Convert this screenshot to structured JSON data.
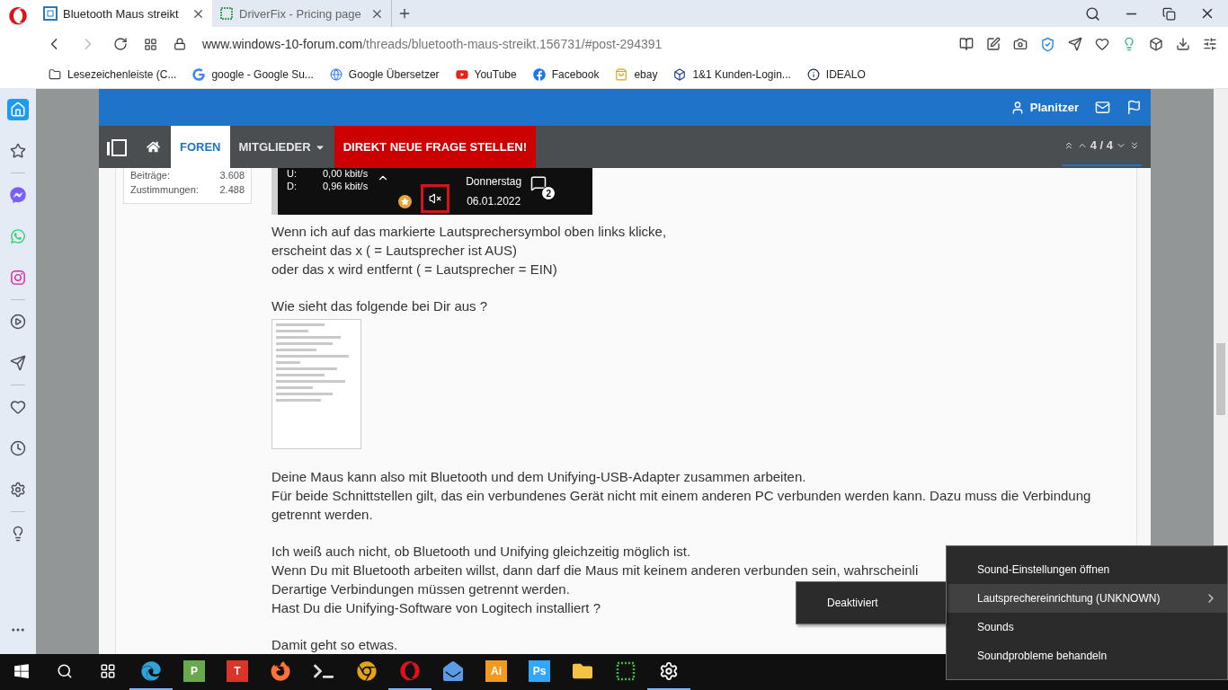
{
  "browser_tabs": [
    {
      "title": "Bluetooth Maus streikt",
      "selected": true,
      "kind": "forum"
    },
    {
      "title": "DriverFix - Pricing page",
      "selected": false,
      "kind": "dots"
    }
  ],
  "address": {
    "host": "www.windows-10-forum.com",
    "path": "/threads/bluetooth-maus-streikt.156731/#post-294391"
  },
  "bookmarks": [
    {
      "kind": "folder",
      "label": "Lesezeichenleiste (C..."
    },
    {
      "kind": "google",
      "label": "google - Google Su..."
    },
    {
      "kind": "translate",
      "label": "Google Übersetzer"
    },
    {
      "kind": "youtube",
      "label": "YouTube"
    },
    {
      "kind": "facebook",
      "label": "Facebook"
    },
    {
      "kind": "bag",
      "label": "ebay"
    },
    {
      "kind": "square",
      "label": "1&1 Kunden-Login..."
    },
    {
      "kind": "info",
      "label": "IDEALO"
    }
  ],
  "sidebar": {
    "groups": [
      {
        "items": [
          {
            "kind": "home",
            "selected": true
          },
          {
            "kind": "star",
            "selected": false
          }
        ]
      },
      {
        "items": [
          {
            "kind": "messenger",
            "selected": false
          },
          {
            "kind": "whatsapp",
            "selected": false
          },
          {
            "kind": "instagram",
            "selected": false
          }
        ]
      },
      {
        "items": [
          {
            "kind": "play",
            "selected": false
          },
          {
            "kind": "send",
            "selected": false
          }
        ]
      },
      {
        "items": [
          {
            "kind": "heart",
            "selected": false
          },
          {
            "kind": "clock",
            "selected": false
          },
          {
            "kind": "settings",
            "selected": false
          }
        ]
      },
      {
        "items": [
          {
            "kind": "bulb",
            "selected": false
          }
        ]
      }
    ]
  },
  "forum_header": {
    "user": "Planitzer"
  },
  "forum_nav": [
    {
      "kind": "tab",
      "label": "FOREN",
      "selected": true
    },
    {
      "kind": "dropdown",
      "label": "MITGLIEDER",
      "selected": false
    },
    {
      "kind": "cta",
      "label": "DIREKT NEUE FRAGE STELLEN!",
      "selected": false
    }
  ],
  "pager": {
    "text": "4 / 4"
  },
  "user_stats": [
    {
      "label": "Beiträge:",
      "value": "3.608"
    },
    {
      "label": "Zustimmungen:",
      "value": "2.488"
    }
  ],
  "embedded_screenshot": {
    "upload_label": "U:",
    "upload": "0,00 kbit/s",
    "download_label": "D:",
    "download": "0,96 kbit/s",
    "day": "Donnerstag",
    "date": "06.01.2022",
    "notifications": "2",
    "muted": true
  },
  "post": [
    {
      "kind": "paragraph",
      "lines": [
        "Wenn ich auf das markierte Lautsprechersymbol oben links klicke,",
        "erscheint das x ( = Lautsprecher ist AUS)",
        "oder das x wird entfernt ( = Lautsprecher = EIN)"
      ]
    },
    {
      "kind": "paragraph",
      "lines": [
        "Wie sieht das folgende bei Dir aus ?"
      ]
    },
    {
      "kind": "image"
    },
    {
      "kind": "paragraph",
      "lines": [
        "Deine Maus kann also mit Bluetooth und dem Unifying-USB-Adapter zusammen arbeiten.",
        "Für beide Schnittstellen gilt, das ein verbundenes Gerät nicht mit einem anderen PC verbunden werden kann. Dazu muss die Verbindung getrennt werden."
      ]
    },
    {
      "kind": "paragraph",
      "lines": [
        "Ich weiß auch nicht, ob Bluetooth und Unifying gleichzeitig möglich ist.",
        "Wenn Du mit Bluetooth arbeiten willst, dann darf die Maus mit keinem anderen verbunden sein, wahrscheinli",
        "Derartige Verbindungen müssen getrennt werden.",
        "Hast Du die Unifying-Software von Logitech installiert ?"
      ]
    },
    {
      "kind": "paragraph",
      "lines": [
        "Damit geht so etwas."
      ]
    }
  ],
  "context_menu": {
    "items": [
      {
        "label": "Sound-Einstellungen öffnen",
        "selected": false,
        "submenu": false
      },
      {
        "label": "Lautsprechereinrichtung (UNKNOWN)",
        "selected": true,
        "submenu": true
      },
      {
        "label": "Sounds",
        "selected": false,
        "submenu": false
      },
      {
        "label": "Soundprobleme behandeln",
        "selected": false,
        "submenu": false
      }
    ]
  },
  "submenu": {
    "items": [
      "Deaktiviert"
    ]
  },
  "taskbar": {
    "apps": [
      {
        "kind": "edge",
        "running": true
      },
      {
        "kind": "tile",
        "label": "P",
        "color": "#6aa84f",
        "running": false
      },
      {
        "kind": "tile",
        "label": "T",
        "color": "#d9352b",
        "running": false
      },
      {
        "kind": "firefox",
        "running": false
      },
      {
        "kind": "terminal",
        "running": false
      },
      {
        "kind": "chrome",
        "running": false
      },
      {
        "kind": "opera",
        "running": true
      },
      {
        "kind": "mail",
        "running": false
      },
      {
        "kind": "tile",
        "label": "Ai",
        "color": "#f29a1f",
        "running": false
      },
      {
        "kind": "tile",
        "label": "Ps",
        "color": "#31a8ff",
        "running": false
      },
      {
        "kind": "folder",
        "running": false
      },
      {
        "kind": "dots",
        "running": false
      },
      {
        "kind": "settings",
        "running": true
      }
    ]
  }
}
